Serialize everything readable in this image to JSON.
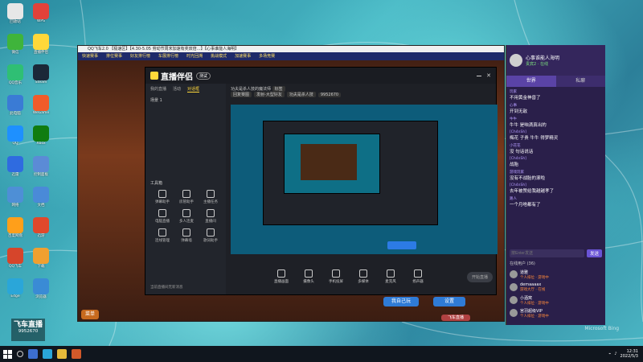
{
  "game": {
    "title": "QQ飞车2.0 【极速区】【4.30-5.05 劳动节周末加速有奖双倍…】【心事谁能人海明】",
    "tabs": [
      "快速赛事",
      "排位赛事",
      "好友排行榜",
      "车展排行榜",
      "时光回溯",
      "挑战模式",
      "加速赛事",
      "多场竞赛"
    ],
    "bottom_left": "菜单",
    "start_btn": "我自己玩",
    "settings_btn": "设置",
    "cam_label": "飞车直播"
  },
  "stream": {
    "logo": "直播伴侣",
    "badge": "测试",
    "tabs": [
      "我的直播",
      "活动",
      "对话框"
    ],
    "scene": "场景 1",
    "room_title": "功夫是杀人技的魔法师",
    "room_tag": "标签",
    "chips": [
      "回复赛图",
      "发射-大型好友",
      "功夫是杀人技",
      "9952670"
    ],
    "tools_title": "工具箱",
    "tools": [
      {
        "label": "弹幕助手"
      },
      {
        "label": "房管助手"
      },
      {
        "label": "主播任务"
      },
      {
        "label": "电脑直播"
      },
      {
        "label": "多人连麦"
      },
      {
        "label": "直播间"
      },
      {
        "label": "连线管理"
      },
      {
        "label": "弹幕墙"
      },
      {
        "label": "歌词助手"
      }
    ],
    "bottom": [
      {
        "label": "直播画面"
      },
      {
        "label": "摄像头"
      },
      {
        "label": "手机投屏"
      },
      {
        "label": "多媒体"
      },
      {
        "label": "麦克风"
      },
      {
        "label": "扬声器"
      }
    ],
    "begin_btn": "开始直播",
    "status": "当前直播间无新消息"
  },
  "chat": {
    "title": "心事谁能人海明",
    "subtitle": "贵宾2 · 在线",
    "tabs": [
      "世界",
      "私聊"
    ],
    "messages": [
      {
        "user": "玩家",
        "text": "不用黄金神兽了"
      },
      {
        "user": "心事",
        "text": "开到无敌"
      },
      {
        "user": "牛牛",
        "text": "牛牛 是咱滴真出的"
      },
      {
        "user": "[Ch4nSh]",
        "text": "梅花 子贵 牛牛 得梦精灵"
      },
      {
        "user": "小花花",
        "text": "没 句话说话"
      },
      {
        "user": "[Ch4nSh]",
        "text": "战胎"
      },
      {
        "user": "游戏玩家",
        "text": "没有不战胎的滚啦"
      },
      {
        "user": "[Ch4nSh]",
        "text": "去年被赞给我越越孝了"
      },
      {
        "user": "路人",
        "text": "一个月啥都有了"
      }
    ],
    "input_placeholder": "按Enter发送",
    "send": "发送",
    "viewers_title": "在线用户 (36)",
    "viewers": [
      {
        "name": "道雅",
        "status": "个人排位 · 游戏中"
      },
      {
        "name": "demaaaax",
        "status": "游戏大厅 · 在线"
      },
      {
        "name": "小酒窝",
        "status": "个人排位 · 游戏中"
      },
      {
        "name": "宫羽超级VIP",
        "status": "个人排位 · 游戏中"
      }
    ]
  },
  "overlay": {
    "logo": "飞车直播",
    "uid": "9952670"
  },
  "taskbar": {
    "time": "12:31",
    "date": "2022/5/3"
  },
  "watermark": "Microsoft Bing",
  "desktop_icons": [
    "回收站",
    "微信",
    "QQ音乐",
    "此电脑",
    "QQ",
    "迅雷",
    "网络",
    "百度网盘",
    "QQ飞车",
    "Edge",
    "WPS",
    "直播伴侣",
    "Steam",
    "WeGame",
    "Xbox",
    "控制面板",
    "文档",
    "迅游",
    "下载",
    "浏览器"
  ]
}
